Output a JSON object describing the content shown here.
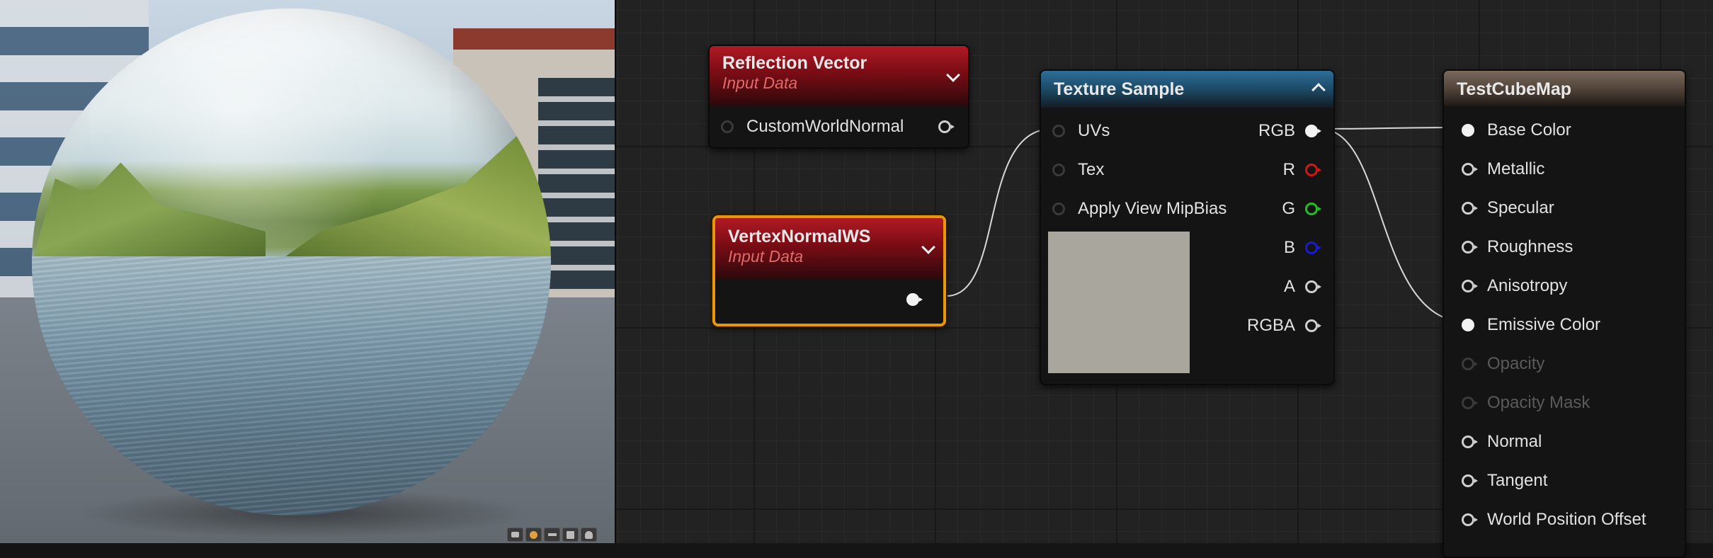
{
  "viewport": {
    "toolbar_icons": [
      "cylinder-icon",
      "sphere-icon",
      "plane-icon",
      "cube-icon",
      "teapot-icon"
    ],
    "active_preview": "sphere-icon"
  },
  "nodes": {
    "reflection_vector": {
      "title": "Reflection Vector",
      "subtitle": "Input Data",
      "output_pin": "CustomWorldNormal"
    },
    "vertex_normal_ws": {
      "title": "VertexNormalWS",
      "subtitle": "Input Data",
      "selected": true
    },
    "texture_sample": {
      "title": "Texture Sample",
      "inputs": [
        "UVs",
        "Tex",
        "Apply View MipBias"
      ],
      "outputs": [
        "RGB",
        "R",
        "G",
        "B",
        "A",
        "RGBA"
      ],
      "preview_color": "#a9a69d"
    },
    "material": {
      "title": "TestCubeMap",
      "inputs": [
        {
          "label": "Base Color",
          "connected": true,
          "enabled": true
        },
        {
          "label": "Metallic",
          "connected": false,
          "enabled": true
        },
        {
          "label": "Specular",
          "connected": false,
          "enabled": true
        },
        {
          "label": "Roughness",
          "connected": false,
          "enabled": true
        },
        {
          "label": "Anisotropy",
          "connected": false,
          "enabled": true
        },
        {
          "label": "Emissive Color",
          "connected": true,
          "enabled": true
        },
        {
          "label": "Opacity",
          "connected": false,
          "enabled": false
        },
        {
          "label": "Opacity Mask",
          "connected": false,
          "enabled": false
        },
        {
          "label": "Normal",
          "connected": false,
          "enabled": true
        },
        {
          "label": "Tangent",
          "connected": false,
          "enabled": true
        },
        {
          "label": "World Position Offset",
          "connected": false,
          "enabled": true
        }
      ]
    }
  },
  "colors": {
    "selection": "#e8950f",
    "input_header": "#b01a24",
    "texture_header": "#2d6e98",
    "material_header": "#7a6a5c",
    "pin_r": "#d21616",
    "pin_g": "#1ec21e",
    "pin_b": "#1a1ad2"
  }
}
